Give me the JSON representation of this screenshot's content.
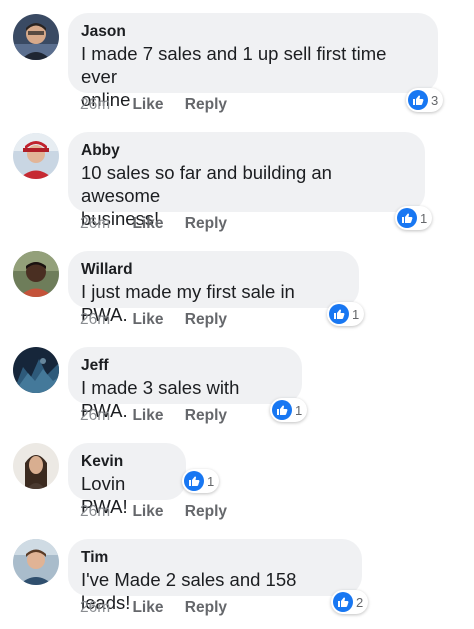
{
  "accent_color": "#1877f2",
  "reaction_icon": "thumbs-up-icon",
  "comments": [
    {
      "author": "Jason",
      "text_lines": [
        "I made 7 sales and 1 up sell first time ever",
        "online"
      ],
      "time": "26m",
      "like": "Like",
      "reply": "Reply",
      "reactions": "3"
    },
    {
      "author": "Abby",
      "text_lines": [
        "10 sales so far and building an awesome",
        "business!"
      ],
      "time": "26m",
      "like": "Like",
      "reply": "Reply",
      "reactions": "1"
    },
    {
      "author": "Willard",
      "text_lines": [
        "I just made my first sale in PWA."
      ],
      "time": "26m",
      "like": "Like",
      "reply": "Reply",
      "reactions": "1"
    },
    {
      "author": "Jeff",
      "text_lines": [
        "I made 3 sales with PWA."
      ],
      "time": "26m",
      "like": "Like",
      "reply": "Reply",
      "reactions": "1"
    },
    {
      "author": "Kevin",
      "text_lines": [
        "Lovin PWA!"
      ],
      "time": "26m",
      "like": "Like",
      "reply": "Reply",
      "reactions": "1"
    },
    {
      "author": "Tim",
      "text_lines": [
        "I've Made 2 sales and 158 leads!"
      ],
      "time": "26m",
      "like": "Like",
      "reply": "Reply",
      "reactions": "2"
    }
  ]
}
